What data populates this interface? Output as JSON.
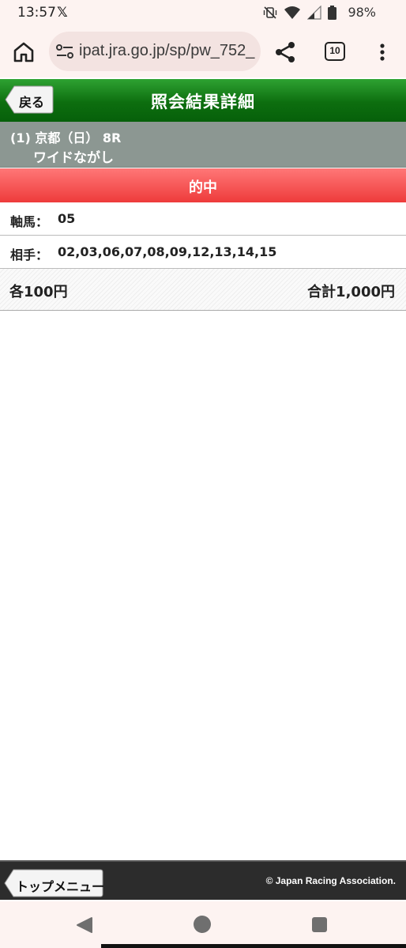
{
  "status": {
    "time": "13:57",
    "x_app": "𝕏",
    "battery": "98%"
  },
  "browser": {
    "url": "ipat.jra.go.jp/sp/pw_752_",
    "tab_count": "10"
  },
  "header": {
    "back_label": "戻る",
    "title": "照会結果詳細"
  },
  "race": {
    "line1": "(1) 京都（日） 8R",
    "bet_type": "ワイドながし"
  },
  "result": {
    "label": "的中"
  },
  "details": {
    "axis_label": "軸馬：",
    "axis_value": "05",
    "partner_label": "相手：",
    "partner_value": "02,03,06,07,08,09,12,13,14,15",
    "each_amount": "各100円",
    "total_amount": "合計1,000円"
  },
  "footer": {
    "top_menu_label": "トップメニュー",
    "copyright": "© Japan Racing Association."
  },
  "colors": {
    "header_green": "#0d6e0f",
    "hit_red": "#ee3b3b",
    "race_gray": "#8c9792"
  }
}
